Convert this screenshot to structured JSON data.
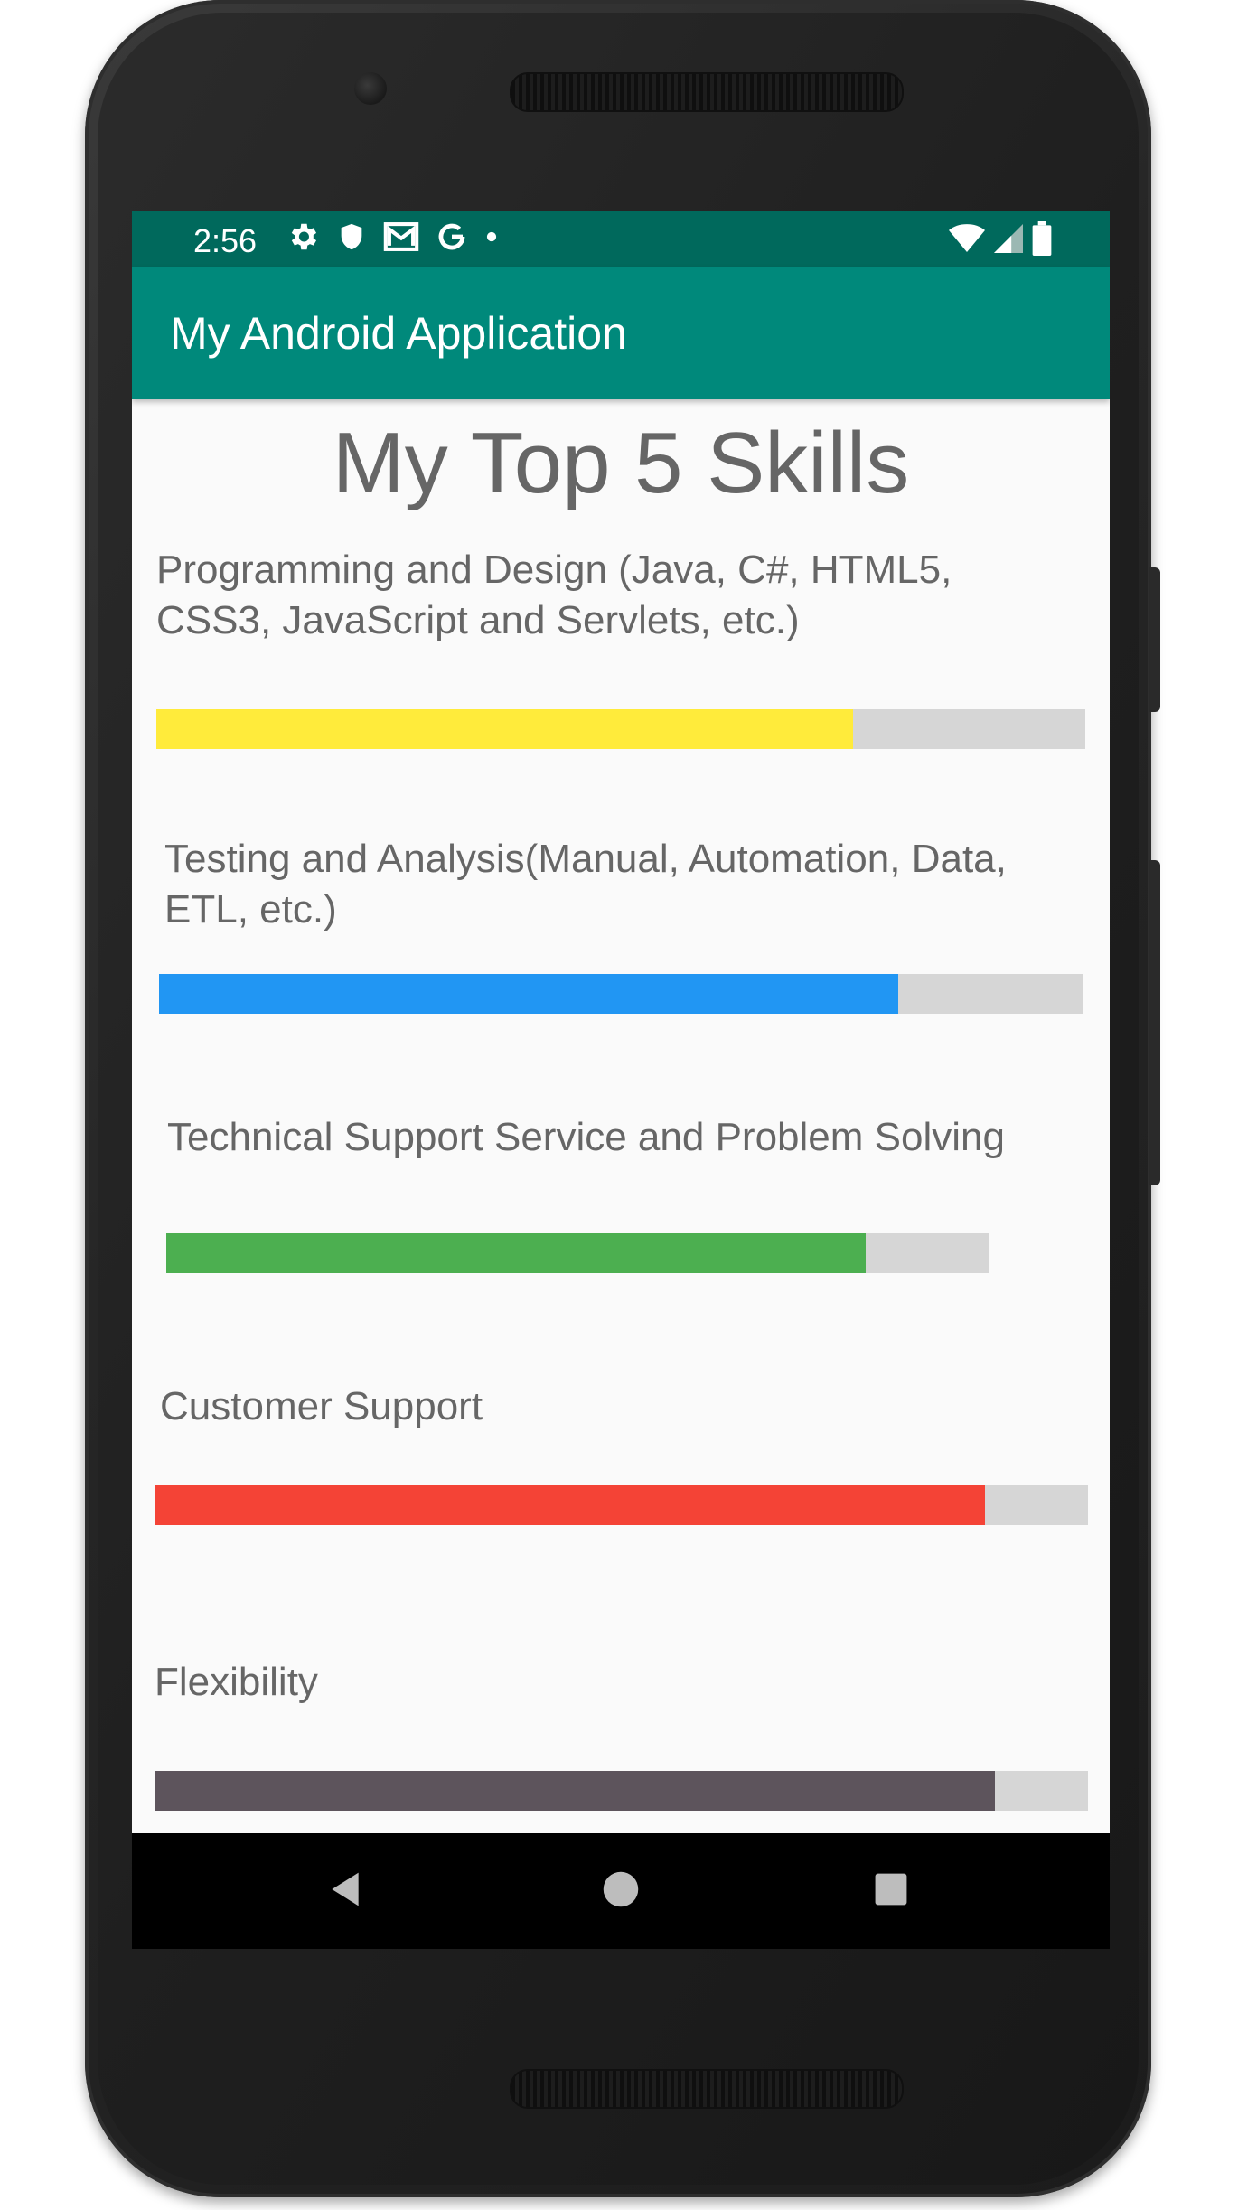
{
  "status_bar": {
    "time": "2:56",
    "icons_left": [
      "gear-icon",
      "shield-icon",
      "mail-icon",
      "google-icon",
      "dot-icon"
    ],
    "icons_right": [
      "wifi-icon",
      "signal-icon",
      "battery-icon"
    ]
  },
  "app_bar": {
    "title": "My Android Application"
  },
  "main": {
    "heading": "My Top 5 Skills",
    "skills": [
      {
        "label_line1": "Programming and Design (Java, C#, HTML5,",
        "label_line2": "CSS3, JavaScript and Servlets, etc.)",
        "progress": 0.75,
        "color": "#ffeb3b"
      },
      {
        "label_line1": "Testing and Analysis(Manual, Automation, Data,",
        "label_line2": "ETL, etc.)",
        "progress": 0.8,
        "color": "#2196f3"
      },
      {
        "label_line1": "Technical Support Service and Problem Solving",
        "label_line2": "",
        "progress": 0.85,
        "color": "#4caf50"
      },
      {
        "label_line1": "Customer Support",
        "label_line2": "",
        "progress": 0.89,
        "color": "#f44336"
      },
      {
        "label_line1": "Flexibility",
        "label_line2": "",
        "progress": 0.9,
        "color": "#5d545c"
      }
    ]
  },
  "nav_bar": {
    "buttons": [
      "back-icon",
      "home-icon",
      "recents-icon"
    ]
  },
  "colors": {
    "status_bar": "#00695c",
    "app_bar": "#00897b",
    "background": "#fafafa",
    "track": "#d6d6d6",
    "text": "#666666"
  }
}
